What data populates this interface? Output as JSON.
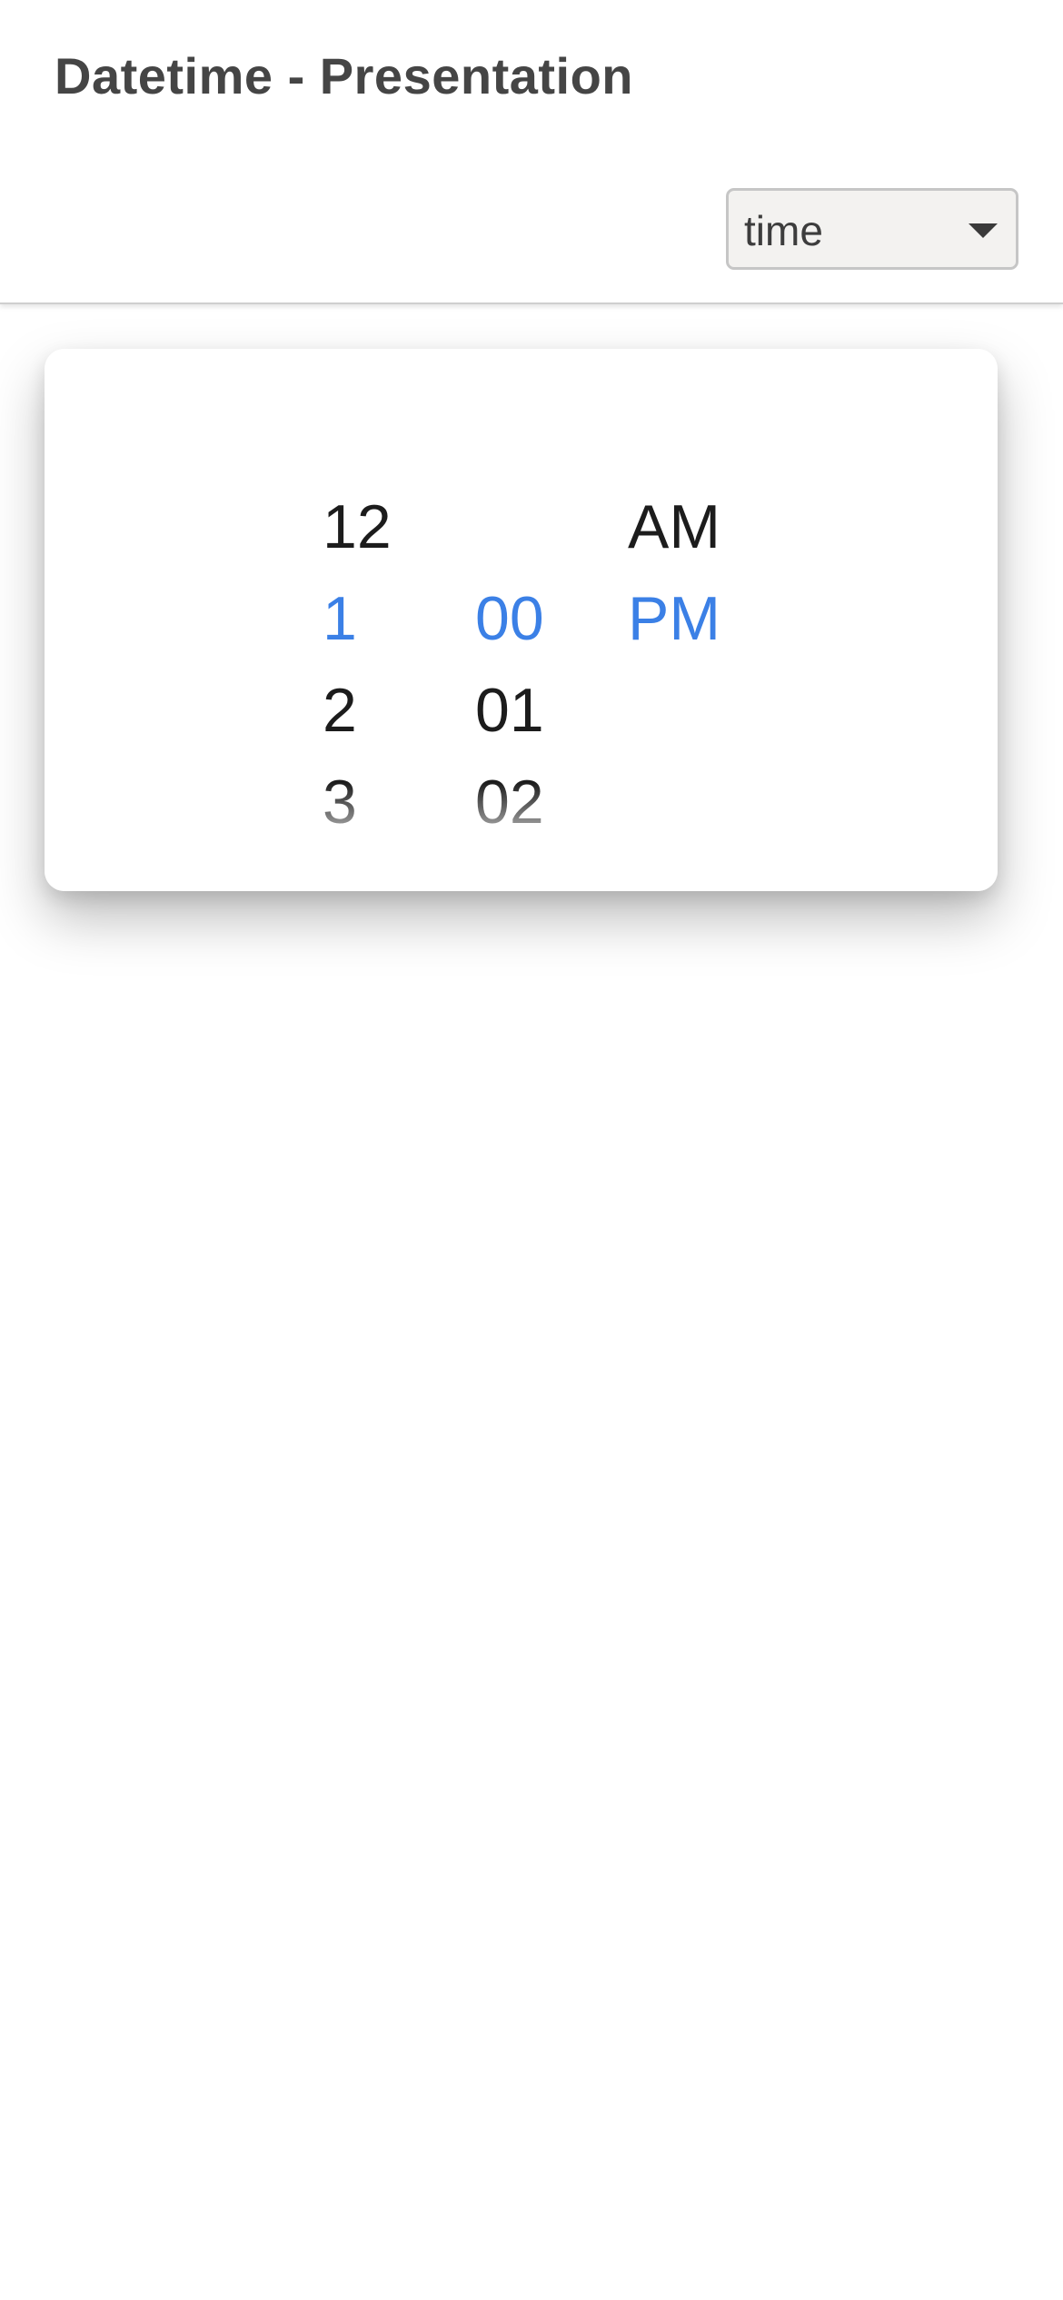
{
  "header": {
    "title": "Datetime - Presentation"
  },
  "presentation_select": {
    "selected": "time"
  },
  "time_picker": {
    "hours": [
      "12",
      "1",
      "2",
      "3"
    ],
    "minutes": [
      "00",
      "01",
      "02"
    ],
    "periods": [
      "AM",
      "PM"
    ],
    "selected": {
      "hour": "1",
      "minute": "00",
      "period": "PM"
    }
  },
  "colors": {
    "accent": "#3b80e6",
    "text": "#1c1c1c",
    "title": "#454545"
  }
}
